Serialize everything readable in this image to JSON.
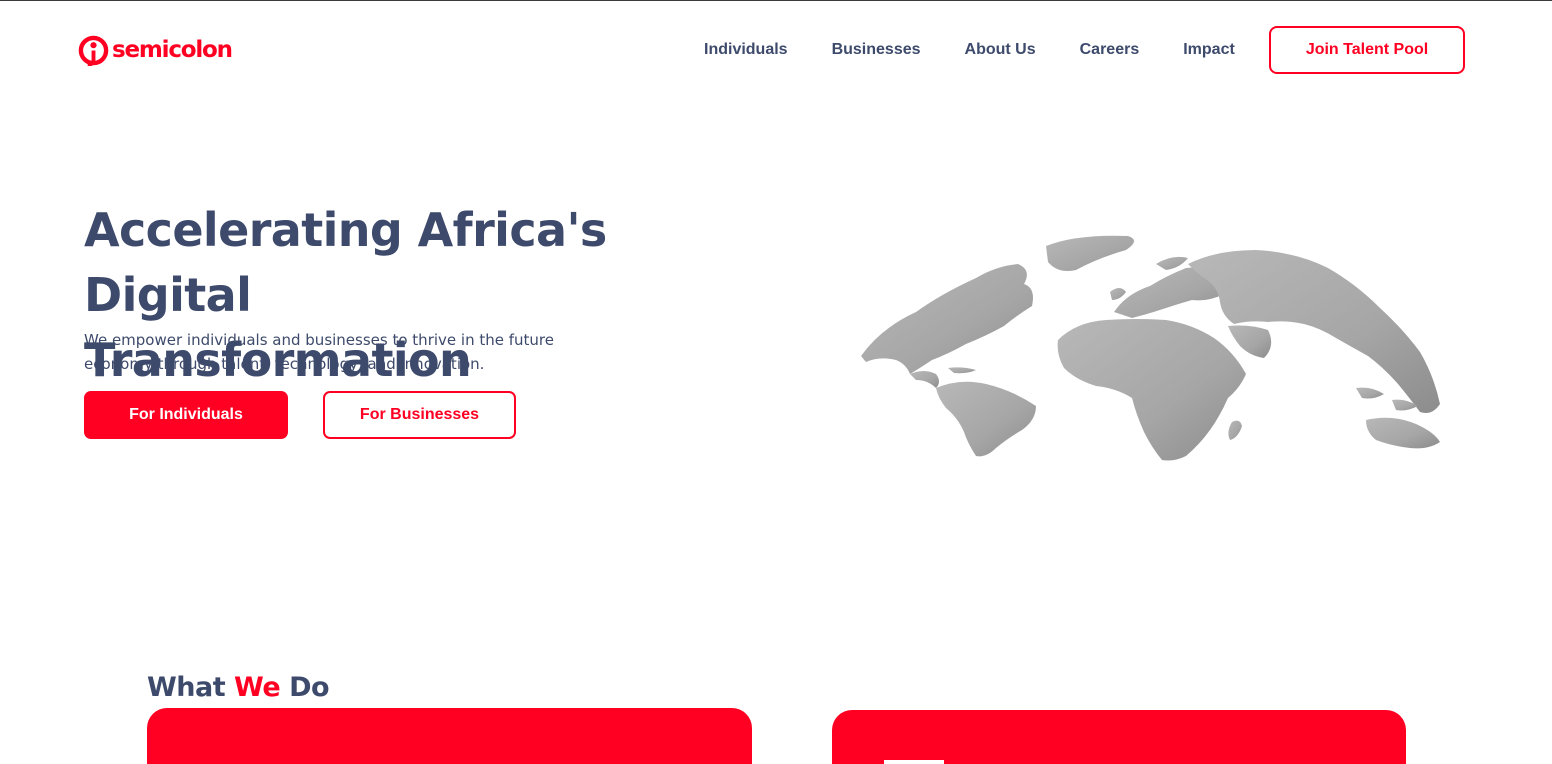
{
  "brand": {
    "name": "semicolon",
    "color": "#ff0022",
    "logo_icon": "semicolon-logo-icon"
  },
  "nav": {
    "items": [
      {
        "label": "Individuals"
      },
      {
        "label": "Businesses"
      },
      {
        "label": "About Us"
      },
      {
        "label": "Careers"
      },
      {
        "label": "Impact"
      }
    ],
    "cta_label": "Join Talent Pool"
  },
  "hero": {
    "title_line1": "Accelerating Africa's",
    "title_line2": "Digital Transformation",
    "subtitle_line1": "We empower individuals and businesses to thrive in the future",
    "subtitle_line2": "economy through talent, technology, and innovation.",
    "primary_button": "For Individuals",
    "secondary_button": "For Businesses",
    "image_icon": "world-map-globe-icon"
  },
  "what_we_do": {
    "title_part1": "What ",
    "title_accent": "We",
    "title_part2": " Do"
  },
  "colors": {
    "accent": "#ff0022",
    "text": "#3d4a6b",
    "map_gray": "#a9a9a9"
  }
}
